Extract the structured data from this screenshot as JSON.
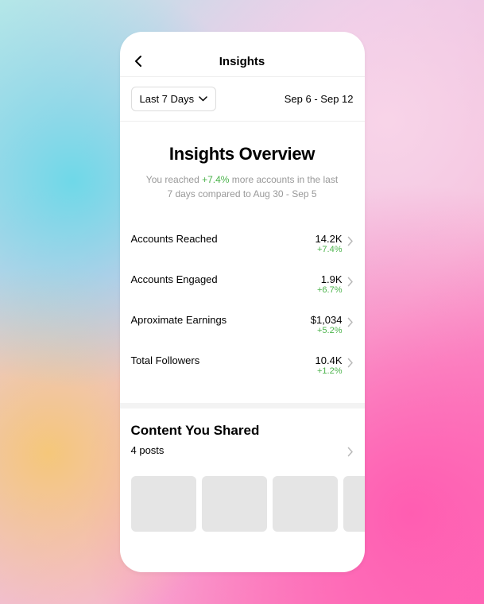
{
  "header": {
    "title": "Insights"
  },
  "filter": {
    "label": "Last 7 Days",
    "range": "Sep 6 - Sep 12"
  },
  "overview": {
    "title": "Insights Overview",
    "sub_pre": "You reached ",
    "sub_pct": "+7.4%",
    "sub_post": " more accounts in the last 7 days compared to Aug 30  - Sep 5"
  },
  "metrics": [
    {
      "label": "Accounts Reached",
      "value": "14.2K",
      "change": "+7.4%"
    },
    {
      "label": "Accounts Engaged",
      "value": "1.9K",
      "change": "+6.7%"
    },
    {
      "label": "Aproximate Earnings",
      "value": "$1,034",
      "change": "+5.2%"
    },
    {
      "label": "Total Followers",
      "value": "10.4K",
      "change": "+1.2%"
    }
  ],
  "content": {
    "title": "Content You Shared",
    "posts": "4 posts"
  }
}
